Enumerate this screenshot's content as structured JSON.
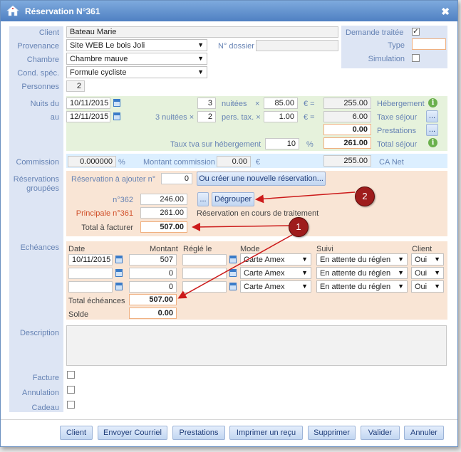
{
  "title": "Réservation N°361",
  "fields": {
    "client_label": "Client",
    "client_value": "Bateau Marie",
    "provenance_label": "Provenance",
    "provenance_value": "Site WEB Le bois Joli",
    "dossier_label": "N° dossier",
    "dossier_value": "",
    "chambre_label": "Chambre",
    "chambre_value": "Chambre mauve",
    "cond_label": "Cond. spéc.",
    "cond_value": "Formule cycliste",
    "personnes_label": "Personnes",
    "personnes_value": "2",
    "demande_label": "Demande traitée",
    "demande_checked": "✓",
    "type_label": "Type",
    "type_value": "",
    "simulation_label": "Simulation",
    "simulation_checked": ""
  },
  "nights": {
    "nuits_label": "Nuits du",
    "date_from": "10/11/2015",
    "au_label": "au",
    "date_to": "12/11/2015",
    "nights_count": "3",
    "nuitees_label": "nuitées",
    "times1": "×",
    "price": "85.00",
    "eq1": "€ =",
    "hebergement_total": "255.00",
    "hebergement_label": "Hébergement",
    "nuitees_prefix": "3 nuitées ×",
    "persons": "2",
    "pers_tax_label": "pers. tax. ×",
    "tax_price": "1.00",
    "eq2": "€ =",
    "taxe_total": "6.00",
    "taxe_label": "Taxe séjour",
    "prestations_total": "0.00",
    "prestations_label": "Prestations",
    "tva_label": "Taux tva sur hébergement",
    "tva_value": "10",
    "percent": "%",
    "total_sejour": "261.00",
    "total_sejour_label": "Total séjour",
    "dots": "..."
  },
  "commission": {
    "label": "Commission",
    "value": "0.000000",
    "percent": "%",
    "montant_label": "Montant commission",
    "montant_value": "0.00",
    "euro": "€",
    "ca_value": "255.00",
    "ca_label": "CA Net"
  },
  "groupees": {
    "label_line1": "Réservations",
    "label_line2": "groupées",
    "ajouter_label": "Réservation à ajouter n°",
    "ajouter_value": "0",
    "creer_button": "Ou créer une nouvelle réservation...",
    "r362_label": "n°362",
    "r362_value": "246.00",
    "dots": "...",
    "degrouper_button": "Dégrouper",
    "principale_label": "Principale n°361",
    "principale_value": "261.00",
    "status_text": "Réservation en cours de traitement",
    "total_label": "Total à facturer",
    "total_value": "507.00"
  },
  "echeances": {
    "label": "Echéances",
    "headers": {
      "date": "Date",
      "montant": "Montant",
      "regle": "Réglé le",
      "mode": "Mode",
      "suivi": "Suivi",
      "client": "Client"
    },
    "rows": [
      {
        "date": "10/11/2015",
        "montant": "507",
        "regle": "",
        "mode": "Carte Amex",
        "suivi": "En attente du réglen",
        "client": "Oui"
      },
      {
        "date": "",
        "montant": "0",
        "regle": "",
        "mode": "Carte Amex",
        "suivi": "En attente du réglen",
        "client": "Oui"
      },
      {
        "date": "",
        "montant": "0",
        "regle": "",
        "mode": "Carte Amex",
        "suivi": "En attente du réglen",
        "client": "Oui"
      }
    ],
    "total_label": "Total échéances",
    "total_value": "507.00",
    "solde_label": "Solde",
    "solde_value": "0.00"
  },
  "misc": {
    "description_label": "Description",
    "description_value": "",
    "facture_label": "Facture",
    "annulation_label": "Annulation",
    "cadeau_label": "Cadeau"
  },
  "buttons": {
    "client": "Client",
    "courriel": "Envoyer Courriel",
    "prestations": "Prestations",
    "imprimer": "Imprimer un reçu",
    "supprimer": "Supprimer",
    "valider": "Valider",
    "annuler": "Annuler"
  },
  "annotations": {
    "marker1": "1",
    "marker2": "2",
    "arrow_color": "#cc1a1a"
  },
  "colors": {
    "title_bar": "#5b8ccb",
    "label_blue": "#6683b4",
    "green_zone": "#e6f2dc",
    "blue_zone": "#dcefff",
    "peach_zone": "#f9e5d5",
    "principale_red": "#d0502a"
  }
}
